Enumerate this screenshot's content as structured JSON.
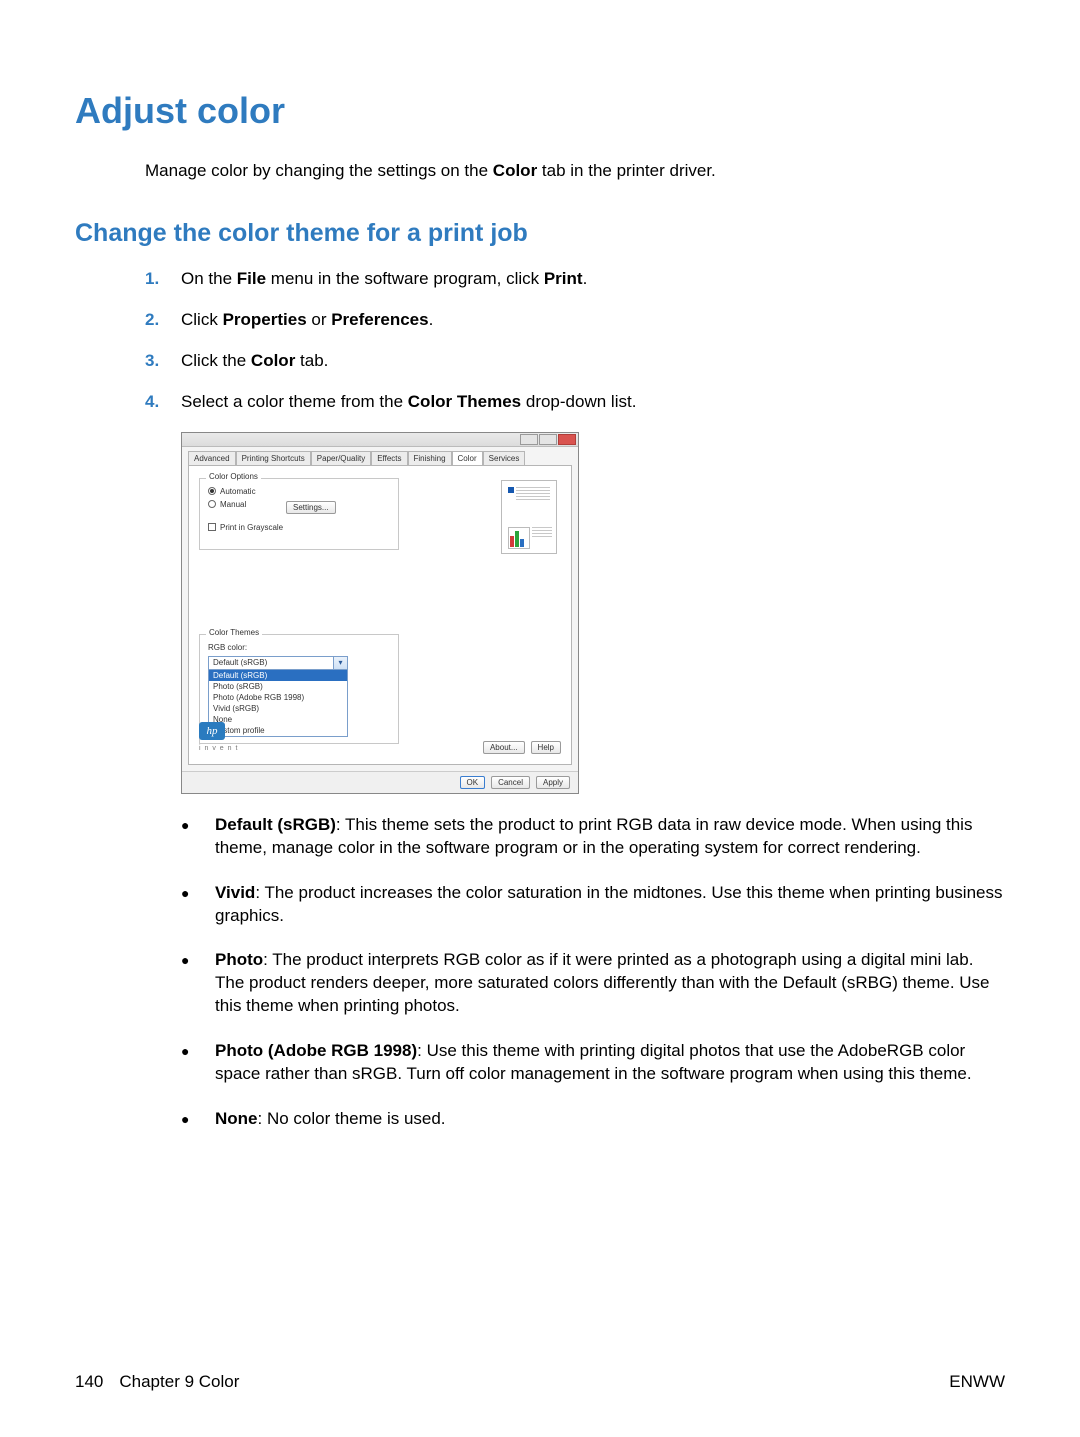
{
  "page": {
    "title": "Adjust color",
    "intro_pre": "Manage color by changing the settings on the ",
    "intro_bold": "Color",
    "intro_post": " tab in the printer driver.",
    "section_title": "Change the color theme for a print job"
  },
  "steps": {
    "s1": {
      "num": "1.",
      "a": "On the ",
      "b": "File",
      "c": " menu in the software program, click ",
      "d": "Print",
      "e": "."
    },
    "s2": {
      "num": "2.",
      "a": "Click ",
      "b": "Properties",
      "c": " or ",
      "d": "Preferences",
      "e": "."
    },
    "s3": {
      "num": "3.",
      "a": "Click the ",
      "b": "Color",
      "c": " tab."
    },
    "s4": {
      "num": "4.",
      "a": "Select a color theme from the ",
      "b": "Color Themes",
      "c": " drop-down list."
    }
  },
  "dialog": {
    "tabs": {
      "advanced": "Advanced",
      "shortcuts": "Printing Shortcuts",
      "paper": "Paper/Quality",
      "effects": "Effects",
      "finishing": "Finishing",
      "color": "Color",
      "services": "Services"
    },
    "color_options": {
      "group": "Color Options",
      "automatic": "Automatic",
      "manual": "Manual",
      "settings_btn": "Settings...",
      "grayscale": "Print in Grayscale"
    },
    "color_themes": {
      "group": "Color Themes",
      "label": "RGB color:",
      "selected": "Default (sRGB)",
      "options": {
        "o0": "Default (sRGB)",
        "o1": "Photo (sRGB)",
        "o2": "Photo (Adobe RGB 1998)",
        "o3": "Vivid (sRGB)",
        "o4": "None",
        "o5": "Custom profile"
      }
    },
    "logo_text": "hp",
    "invent": "i n v e n t",
    "buttons": {
      "about": "About...",
      "help": "Help",
      "ok": "OK",
      "cancel": "Cancel",
      "apply": "Apply"
    }
  },
  "bullets": {
    "b1": {
      "bold": "Default (sRGB)",
      "text": ": This theme sets the product to print RGB data in raw device mode. When using this theme, manage color in the software program or in the operating system for correct rendering."
    },
    "b2": {
      "bold": "Vivid",
      "text": ": The product increases the color saturation in the midtones. Use this theme when printing business graphics."
    },
    "b3": {
      "bold": "Photo",
      "text": ": The product interprets RGB color as if it were printed as a photograph using a digital mini lab. The product renders deeper, more saturated colors differently than with the Default (sRBG) theme. Use this theme when printing photos."
    },
    "b4": {
      "bold": "Photo (Adobe RGB 1998)",
      "text": ": Use this theme with printing digital photos that use the AdobeRGB color space rather than sRGB. Turn off color management in the software program when using this theme."
    },
    "b5": {
      "bold": "None",
      "text": ": No color theme is used."
    }
  },
  "footer": {
    "page_num": "140",
    "chapter": "Chapter 9   Color",
    "right": "ENWW"
  }
}
